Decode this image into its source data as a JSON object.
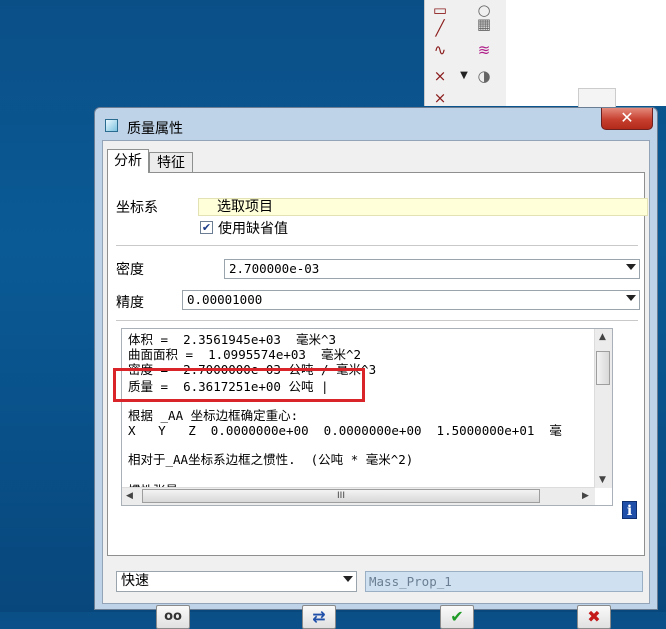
{
  "dialog": {
    "title": "质量属性",
    "close_glyph": "✕"
  },
  "tabs": [
    {
      "label": "分析",
      "active": true
    },
    {
      "label": "特征",
      "active": false
    }
  ],
  "coord_system": {
    "label": "坐标系",
    "select_text": "选取项目",
    "use_default_label": "使用缺省值",
    "use_default_checked": true
  },
  "density": {
    "label": "密度",
    "value": "2.700000e-03"
  },
  "accuracy": {
    "label": "精度",
    "value": "0.00001000"
  },
  "results": {
    "lines": [
      "体积 =  2.3561945e+03  毫米^3",
      "曲面面积 =  1.0995574e+03  毫米^2",
      "密度 =  2.7000000e-03 公吨 / 毫米^3",
      "质量 =  6.3617251e+00 公吨 |",
      "",
      "根据 _AA 坐标边框确定重心:",
      "X   Y   Z  0.0000000e+00  0.0000000e+00  1.5000000e+01  毫",
      "",
      "相对于_AA坐标系边框之惯性.  (公吨 * 毫米^2)",
      "",
      "惯性张量"
    ],
    "hscroll_grip": "III"
  },
  "mode_select": {
    "value": "快速"
  },
  "name_field": {
    "value": "Mass_Prop_1"
  },
  "colors": {
    "highlight": "#d9242a",
    "ok_green": "#1e9a26",
    "cancel_red": "#c41a1a",
    "refresh_blue": "#1f4fa8"
  },
  "icons": {
    "preview": "eyeglasses-icon",
    "repeat": "refresh-arrows-icon",
    "ok": "checkmark-icon",
    "cancel": "x-mark-icon",
    "info": "info-icon"
  }
}
